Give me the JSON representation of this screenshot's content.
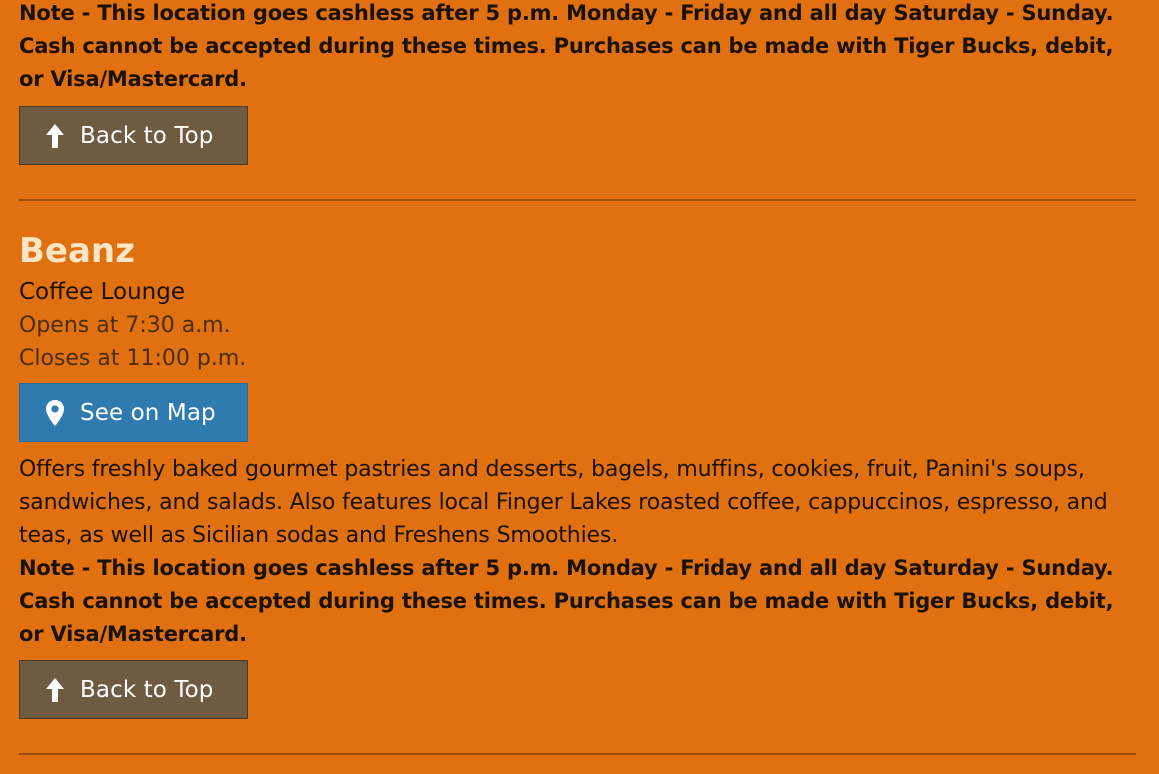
{
  "previous_location": {
    "note": "Note - This location goes cashless after 5 p.m. Monday - Friday and all day Saturday - Sunday. Cash cannot be accepted during these times. Purchases can be made with Tiger Bucks, debit, or Visa/Mastercard.",
    "back_to_top_label": "Back to Top"
  },
  "location": {
    "name": "Beanz",
    "type": "Coffee Lounge",
    "opens": "Opens at 7:30 a.m.",
    "closes": "Closes at 11:00 p.m.",
    "map_button_label": "See on Map",
    "description": "Offers freshly baked gourmet pastries and desserts, bagels, muffins, cookies, fruit, Panini's soups, sandwiches, and salads. Also features local Finger Lakes roasted coffee, cappuccinos, espresso, and teas, as well as Sicilian sodas and Freshens Smoothies.",
    "note": "Note - This location goes cashless after 5 p.m. Monday - Friday and all day Saturday - Sunday. Cash cannot be accepted during these times. Purchases can be made with Tiger Bucks, debit, or Visa/Mastercard.",
    "back_to_top_label": "Back to Top"
  },
  "icons": {
    "back_to_top": "arrow-up-icon",
    "map": "map-pin-icon"
  },
  "colors": {
    "background": "#e07010",
    "title": "#fde6c6",
    "back_button": "#6e5b41",
    "map_button": "#2f7bb0",
    "divider": "#9a4e0e"
  }
}
